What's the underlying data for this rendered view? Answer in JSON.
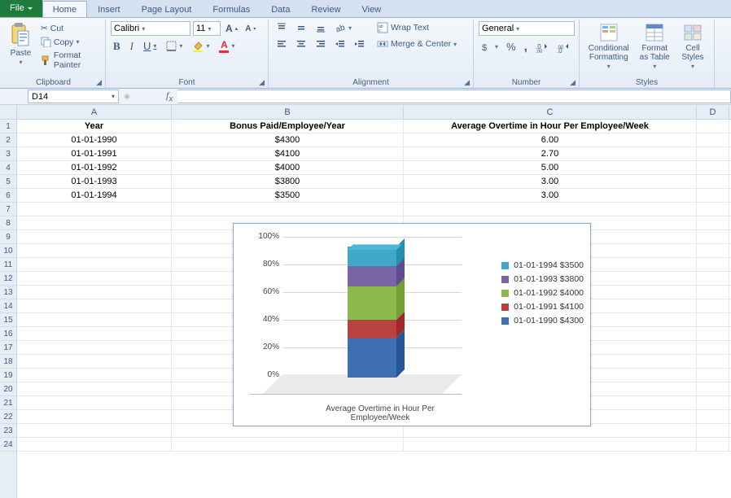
{
  "tabs": {
    "file": "File",
    "home": "Home",
    "insert": "Insert",
    "pagelayout": "Page Layout",
    "formulas": "Formulas",
    "data": "Data",
    "review": "Review",
    "view": "View"
  },
  "clipboard": {
    "paste": "Paste",
    "cut": "Cut",
    "copy": "Copy",
    "fmtpainter": "Format Painter",
    "title": "Clipboard"
  },
  "font": {
    "name": "Calibri",
    "size": "11",
    "title": "Font",
    "bold": "B",
    "italic": "I",
    "underline": "U"
  },
  "alignment": {
    "wrap": "Wrap Text",
    "merge": "Merge & Center",
    "title": "Alignment"
  },
  "number": {
    "fmt": "General",
    "title": "Number"
  },
  "styles": {
    "cond": "Conditional",
    "cond2": "Formatting",
    "fat": "Format",
    "fat2": "as Table",
    "cell": "Cell",
    "cell2": "Styles",
    "title": "Styles"
  },
  "namebox": "D14",
  "columns": {
    "A": "A",
    "B": "B",
    "C": "C",
    "D": "D"
  },
  "table": {
    "headers": {
      "A": "Year",
      "B": "Bonus Paid/Employee/Year",
      "C": "Average Overtime in Hour Per Employee/Week"
    },
    "rows": [
      {
        "A": "01-01-1990",
        "B": "$4300",
        "C": "6.00"
      },
      {
        "A": "01-01-1991",
        "B": "$4100",
        "C": "2.70"
      },
      {
        "A": "01-01-1992",
        "B": "$4000",
        "C": "5.00"
      },
      {
        "A": "01-01-1993",
        "B": "$3800",
        "C": "3.00"
      },
      {
        "A": "01-01-1994",
        "B": "$3500",
        "C": "3.00"
      }
    ]
  },
  "chart_data": {
    "type": "bar",
    "stacked": true,
    "percent": true,
    "three_d": true,
    "xlabel": "Average Overtime in Hour Per Employee/Week",
    "ylabel": "",
    "ylim": [
      0,
      100
    ],
    "yticks": [
      "0%",
      "20%",
      "40%",
      "60%",
      "80%",
      "100%"
    ],
    "categories": [
      "Average Overtime in Hour Per Employee/Week"
    ],
    "series": [
      {
        "name": "01-01-1990 $4300",
        "values": [
          6.0
        ],
        "percent": [
          30.5
        ],
        "color": "#3e6fb0"
      },
      {
        "name": "01-01-1991 $4100",
        "values": [
          2.7
        ],
        "percent": [
          13.7
        ],
        "color": "#b94240"
      },
      {
        "name": "01-01-1992 $4000",
        "values": [
          5.0
        ],
        "percent": [
          25.4
        ],
        "color": "#8cb94b"
      },
      {
        "name": "01-01-1993 $3800",
        "values": [
          3.0
        ],
        "percent": [
          15.2
        ],
        "color": "#7a64a8"
      },
      {
        "name": "01-01-1994 $3500",
        "values": [
          3.0
        ],
        "percent": [
          15.2
        ],
        "color": "#3fa7c7"
      }
    ],
    "legend_order": [
      4,
      3,
      2,
      1,
      0
    ]
  },
  "rowcount": 24
}
